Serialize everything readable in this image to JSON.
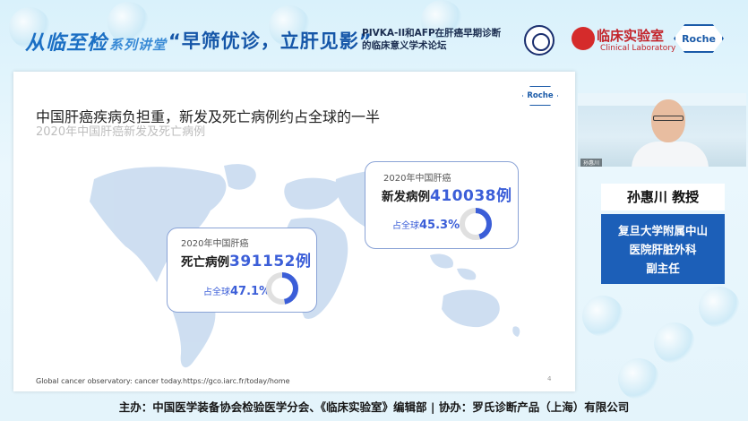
{
  "header": {
    "series_brand": "从临至检",
    "series_suffix": "系列讲堂",
    "slogan": "“早筛优诊，立肝见影”",
    "forum_line1": "PIVKA-II和AFP在肝癌早期诊断",
    "forum_line2": "的临床意义学术论坛",
    "lab_logo_cn": "临床实验室",
    "lab_logo_en": "Clinical Laboratory",
    "roche_logo": "Roche"
  },
  "slide": {
    "title": "中国肝癌疾病负担重，新发及死亡病例约占全球的一半",
    "subtitle": "2020年中国肝癌新发及死亡病例",
    "roche_logo": "Roche",
    "new_cases": {
      "year_label": "2020年中国肝癌",
      "label": "新发病例",
      "value": "410038例",
      "share_label": "占全球",
      "share_value": "45.3%",
      "share_pct": 45.3
    },
    "deaths": {
      "year_label": "2020年中国肝癌",
      "label": "死亡病例",
      "value": "391152例",
      "share_label": "占全球",
      "share_value": "47.1%",
      "share_pct": 47.1
    },
    "source": "Global cancer observatory: cancer today.https://gco.iarc.fr/today/home",
    "page_number": "4"
  },
  "speaker": {
    "name": "孙惠川 教授",
    "affiliation_line1": "复旦大学附属中山",
    "affiliation_line2": "医院肝脏外科",
    "affiliation_line3": "副主任",
    "video_tag": "孙惠川"
  },
  "footer": {
    "text": "主办：中国医学装备协会检验医学分会、《临床实验室》编辑部 | 协办：罗氏诊断产品（上海）有限公司"
  },
  "colors": {
    "accent_blue": "#3b5ed8",
    "donut_track": "#e0e0e0",
    "map_blue": "#c5d8ef",
    "card_blue": "#1c5fb8"
  }
}
